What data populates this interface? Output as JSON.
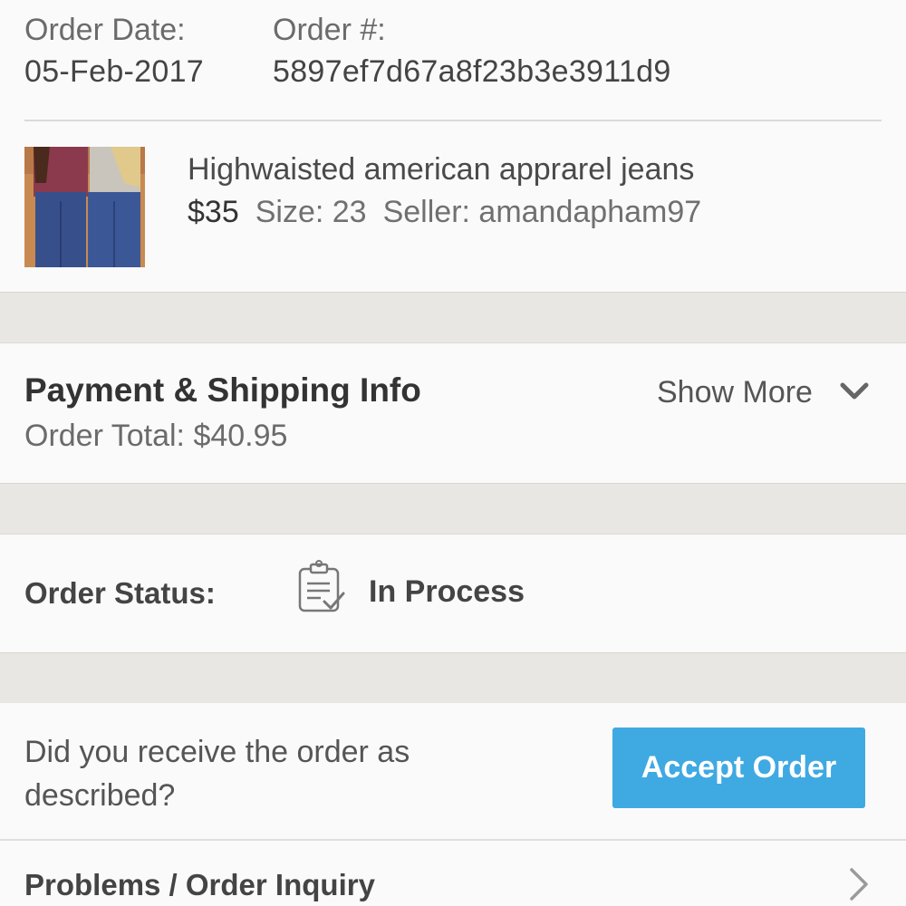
{
  "order": {
    "date_label": "Order Date:",
    "date_value": "05-Feb-2017",
    "number_label": "Order #:",
    "number_value": "5897ef7d67a8f23b3e3911d9"
  },
  "item": {
    "title": "Highwaisted american apprarel jeans",
    "price": "$35",
    "size": "Size: 23",
    "seller": "Seller: amandapham97",
    "image_icon": "product-photo-jeans"
  },
  "payment": {
    "title": "Payment & Shipping Info",
    "total": "Order Total: $40.95",
    "show_more": "Show More",
    "show_more_icon": "chevron-down-icon"
  },
  "status": {
    "label": "Order Status:",
    "value": "In Process",
    "icon": "clipboard-check-icon"
  },
  "receive": {
    "question": "Did you receive the order as described?",
    "accept_label": "Accept Order",
    "accent_color": "#3fa9e2"
  },
  "problems": {
    "label": "Problems / Order Inquiry",
    "icon": "chevron-right-icon"
  }
}
